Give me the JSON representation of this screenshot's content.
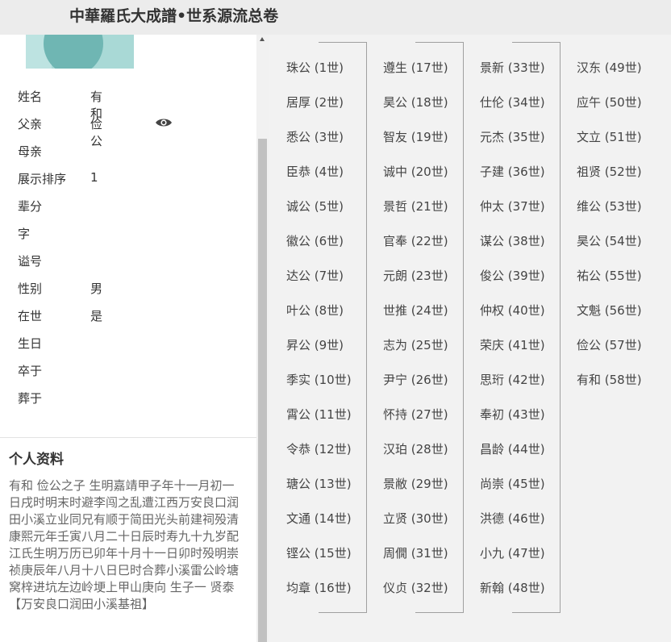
{
  "page": {
    "title": "中華羅氏大成譜•世系源流总卷"
  },
  "profile": {
    "fields": [
      {
        "label": "姓名",
        "value": "有和"
      },
      {
        "label": "父亲",
        "value": "俭公",
        "icon": "eye-icon"
      },
      {
        "label": "母亲",
        "value": ""
      },
      {
        "label": "展示排序",
        "value": "1"
      },
      {
        "label": "辈分",
        "value": ""
      },
      {
        "label": "字",
        "value": ""
      },
      {
        "label": "谥号",
        "value": ""
      },
      {
        "label": "性别",
        "value": "男"
      },
      {
        "label": "在世",
        "value": "是"
      },
      {
        "label": "生日",
        "value": ""
      },
      {
        "label": "卒于",
        "value": ""
      },
      {
        "label": "葬于",
        "value": ""
      }
    ]
  },
  "personal": {
    "title": "个人资料",
    "bio": "有和  俭公之子  生明嘉靖甲子年十一月初一日戌时明末时避李闯之乱遭江西万安良口润田小溪立业同兄有顺于简田光头前建祠殁清康熙元年壬寅八月二十日辰时寿九十九岁配江氏生明万历已卯年十月十一日卯时殁明崇祯庚辰年八月十八日巳时合葬小溪雷公岭塘窝梓进坑左边岭埂上甲山庚向  生子一  贤泰",
    "note": "【万安良口润田小溪基祖】"
  },
  "generations": [
    [
      "珠公 (1世)",
      "居厚 (2世)",
      "悉公 (3世)",
      "臣恭 (4世)",
      "诚公 (5世)",
      "徽公 (6世)",
      "达公 (7世)",
      "叶公 (8世)",
      "昇公 (9世)",
      "季实 (10世)",
      "霄公 (11世)",
      "令恭 (12世)",
      "瑭公 (13世)",
      "文通 (14世)",
      "铿公 (15世)",
      "均章 (16世)"
    ],
    [
      "遵生 (17世)",
      "昊公 (18世)",
      "智友 (19世)",
      "诚中 (20世)",
      "景哲 (21世)",
      "官奉 (22世)",
      "元朗 (23世)",
      "世推 (24世)",
      "志为 (25世)",
      "尹宁 (26世)",
      "怀持 (27世)",
      "汉珀 (28世)",
      "景敝 (29世)",
      "立贤 (30世)",
      "周僩 (31世)",
      "仪贞 (32世)"
    ],
    [
      "景新 (33世)",
      "仕伦 (34世)",
      "元杰 (35世)",
      "子建 (36世)",
      "仲太 (37世)",
      "谋公 (38世)",
      "俊公 (39世)",
      "仲权 (40世)",
      "荣庆 (41世)",
      "思珩 (42世)",
      "奉初 (43世)",
      "昌龄 (44世)",
      "尚崇 (45世)",
      "洪德 (46世)",
      "小九 (47世)",
      "新翰 (48世)"
    ],
    [
      "汉东 (49世)",
      "应午 (50世)",
      "文立 (51世)",
      "祖贤 (52世)",
      "维公 (53世)",
      "昊公 (54世)",
      "祐公 (55世)",
      "文魁 (56世)",
      "俭公 (57世)",
      "有和 (58世)"
    ]
  ]
}
